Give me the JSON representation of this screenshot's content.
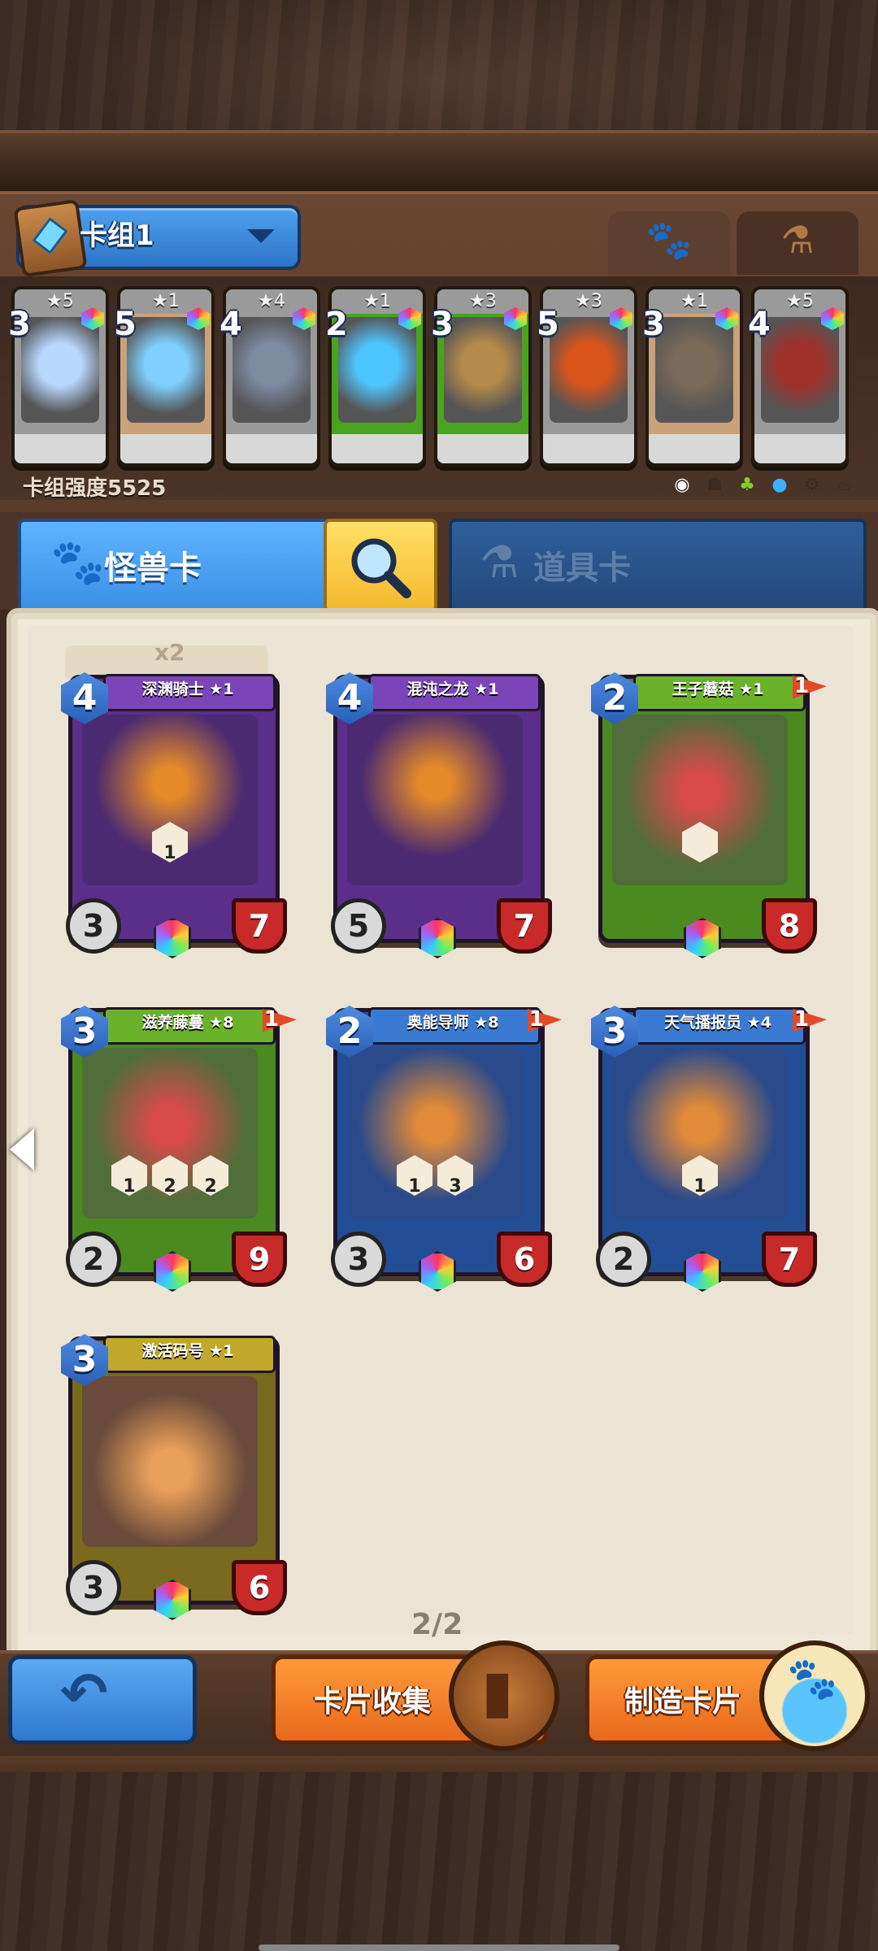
{
  "deck": {
    "name": "卡组1",
    "power_label": "卡组强度5525",
    "tabs": [
      "paw",
      "potion"
    ],
    "cards": [
      {
        "cost": "3",
        "stars": "★5",
        "art": "mirror",
        "color": "#b9d8ff",
        "frame": "#9a9a9a"
      },
      {
        "cost": "5",
        "stars": "★1",
        "art": "ice-crystal",
        "color": "#7fd0ff",
        "frame": "#c9a27a"
      },
      {
        "cost": "4",
        "stars": "★4",
        "art": "battle-axe",
        "color": "#7e8aa0",
        "frame": "#9a9a9a"
      },
      {
        "cost": "2",
        "stars": "★1",
        "art": "ice-rune",
        "color": "#4ec5ff",
        "frame": "#4aa31e"
      },
      {
        "cost": "3",
        "stars": "★3",
        "art": "armor",
        "color": "#b58a4a",
        "frame": "#4aa31e"
      },
      {
        "cost": "5",
        "stars": "★3",
        "art": "flame-sword",
        "color": "#d9541a",
        "frame": "#9a9a9a"
      },
      {
        "cost": "3",
        "stars": "★1",
        "art": "bomb",
        "color": "#7a6a5a",
        "frame": "#c9a27a"
      },
      {
        "cost": "4",
        "stars": "★5",
        "art": "fire-knight",
        "color": "#a0302a",
        "frame": "#9a9a9a"
      }
    ],
    "filters": [
      "all",
      "dark",
      "nature",
      "water",
      "tech",
      "fire"
    ]
  },
  "categories": {
    "monster_label": "怪兽卡",
    "item_label": "道具卡",
    "search_icon": "magnifier-icon"
  },
  "collection": {
    "dup_label": "x2",
    "page": "2/2",
    "cards": [
      {
        "name": "深渊骑士 ★1",
        "cost": "4",
        "atk": "3",
        "hp": "7",
        "flag": "",
        "traits": [
          "1"
        ],
        "theme": "purple"
      },
      {
        "name": "混沌之龙 ★1",
        "cost": "4",
        "atk": "5",
        "hp": "7",
        "flag": "",
        "traits": [],
        "theme": "purple"
      },
      {
        "name": "王子蘑菇 ★1",
        "cost": "2",
        "atk": "",
        "hp": "8",
        "flag": "1",
        "traits": [
          ""
        ],
        "theme": "green"
      },
      {
        "name": "滋养藤蔓 ★8",
        "cost": "3",
        "atk": "2",
        "hp": "9",
        "flag": "1",
        "traits": [
          "1",
          "2",
          "2"
        ],
        "theme": "green"
      },
      {
        "name": "奥能导师 ★8",
        "cost": "2",
        "atk": "3",
        "hp": "6",
        "flag": "1",
        "traits": [
          "1",
          "3"
        ],
        "theme": "blue"
      },
      {
        "name": "天气播报员 ★4",
        "cost": "3",
        "atk": "2",
        "hp": "7",
        "flag": "1",
        "traits": [
          "1"
        ],
        "theme": "blue"
      },
      {
        "name": "激活码号 ★1",
        "cost": "3",
        "atk": "3",
        "hp": "6",
        "flag": "",
        "traits": [],
        "theme": "gold"
      }
    ]
  },
  "bottom": {
    "back_icon": "back-arrow-icon",
    "collect_label": "卡片收集",
    "craft_label": "制造卡片"
  },
  "colors": {
    "blue_accent": "#3a8fe4",
    "orange_button": "#e7691c",
    "parchment": "#efe8d8"
  }
}
